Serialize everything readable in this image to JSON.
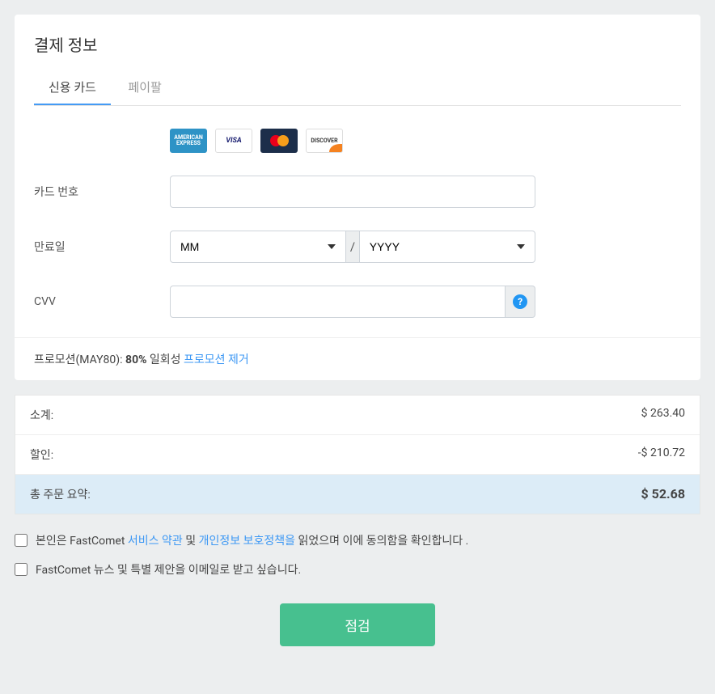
{
  "header": {
    "title": "결제 정보"
  },
  "tabs": {
    "credit_card": "신용 카드",
    "paypal": "페이팔"
  },
  "labels": {
    "card_number": "카드 번호",
    "expiry": "만료일",
    "cvv": "CVV"
  },
  "selects": {
    "month_placeholder": "MM",
    "year_placeholder": "YYYY",
    "separator": "/"
  },
  "promo": {
    "prefix": "프로모션(MAY80): ",
    "percent": "80%",
    "onetime": " 일회성 ",
    "remove": "프로모션 제거"
  },
  "summary": {
    "subtotal_label": "소계:",
    "subtotal_value": "$ 263.40",
    "discount_label": "할인:",
    "discount_value": "-$ 210.72",
    "total_label": "총 주문 요약:",
    "total_value": "$ 52.68"
  },
  "checkboxes": {
    "terms_prefix": "본인은 FastComet ",
    "terms_tos": "서비스 약관",
    "terms_and": " 및 ",
    "terms_privacy": "개인정보 보호정책을",
    "terms_suffix": " 읽었으며 이에 동의함을 확인합니다 .",
    "newsletter": "FastComet 뉴스 및 특별 제안을 이메일로 받고 싶습니다."
  },
  "buttons": {
    "submit": "점검"
  },
  "cards": {
    "amex": "AMERICAN EXPRESS",
    "visa": "VISA",
    "discover": "DISCOVER"
  }
}
